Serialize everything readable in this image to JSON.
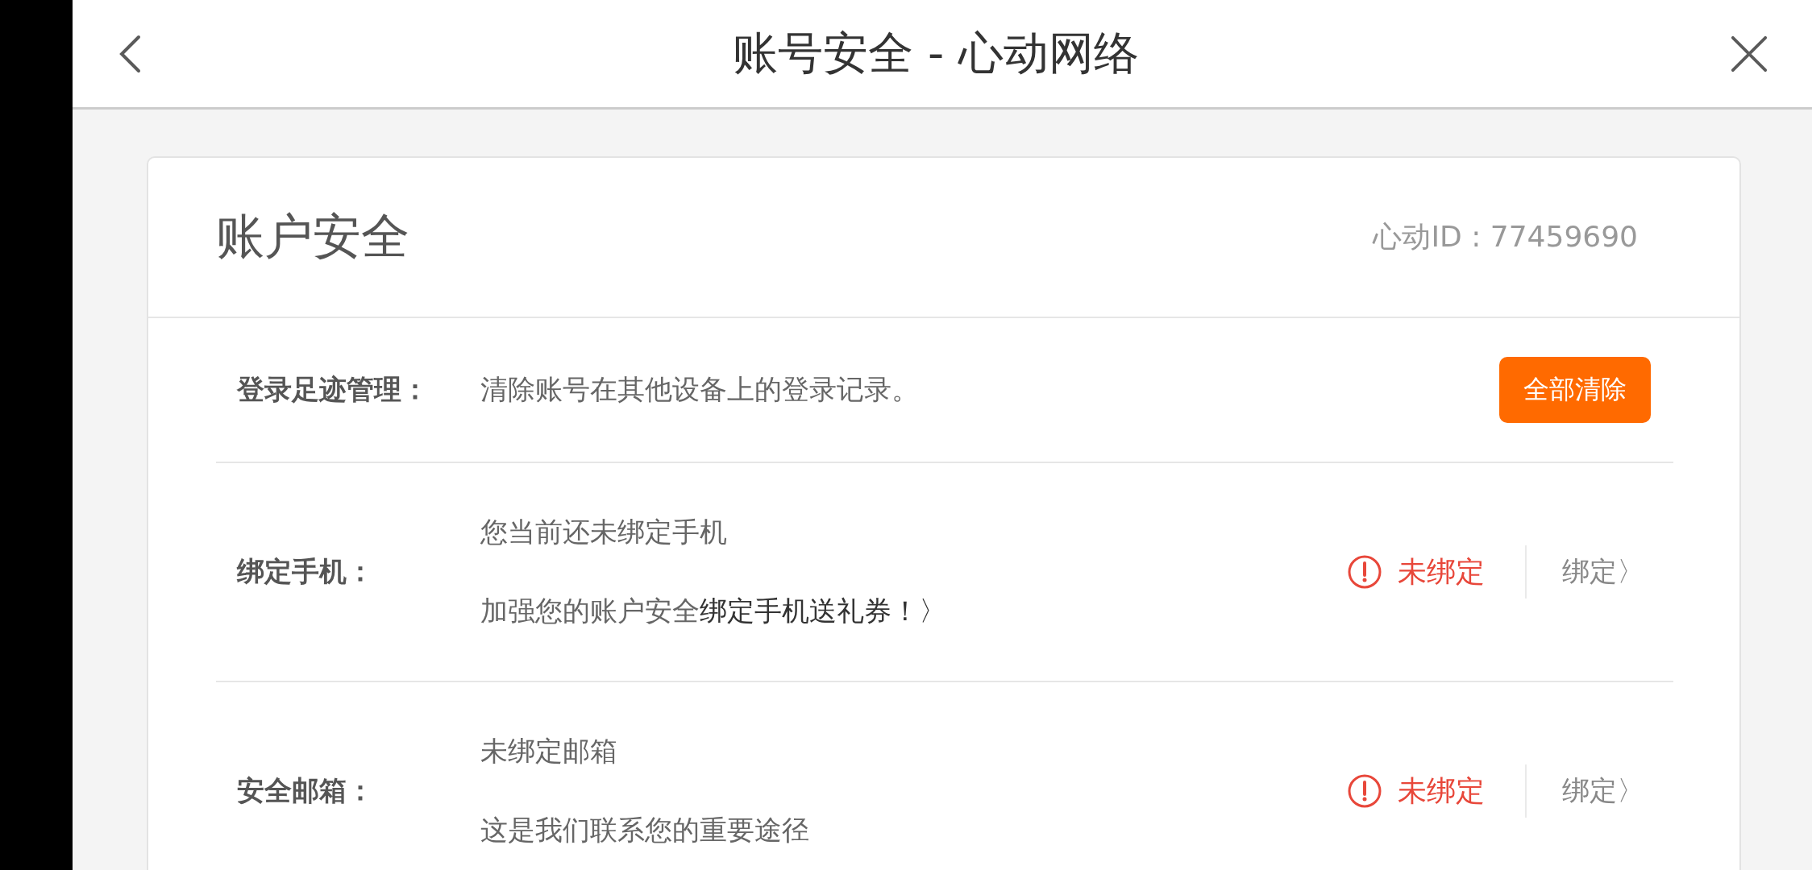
{
  "header": {
    "title": "账号安全 - 心动网络"
  },
  "card": {
    "title": "账户安全",
    "account_id": "心动ID : 77459690"
  },
  "rows": [
    {
      "kind": "action",
      "label": "登录足迹管理：",
      "description": "清除账号在其他设备上的登录记录。",
      "button": "全部清除"
    },
    {
      "kind": "binding",
      "label": "绑定手机：",
      "line1": "您当前还未绑定手机",
      "line2": "加强您的账户安全",
      "promo_link": "绑定手机送礼券！〉",
      "status": "未绑定",
      "action": "绑定〉"
    },
    {
      "kind": "binding",
      "label": "安全邮箱：",
      "line1": "未绑定邮箱",
      "line2": "这是我们联系您的重要途径",
      "status": "未绑定",
      "action": "绑定〉"
    }
  ]
}
